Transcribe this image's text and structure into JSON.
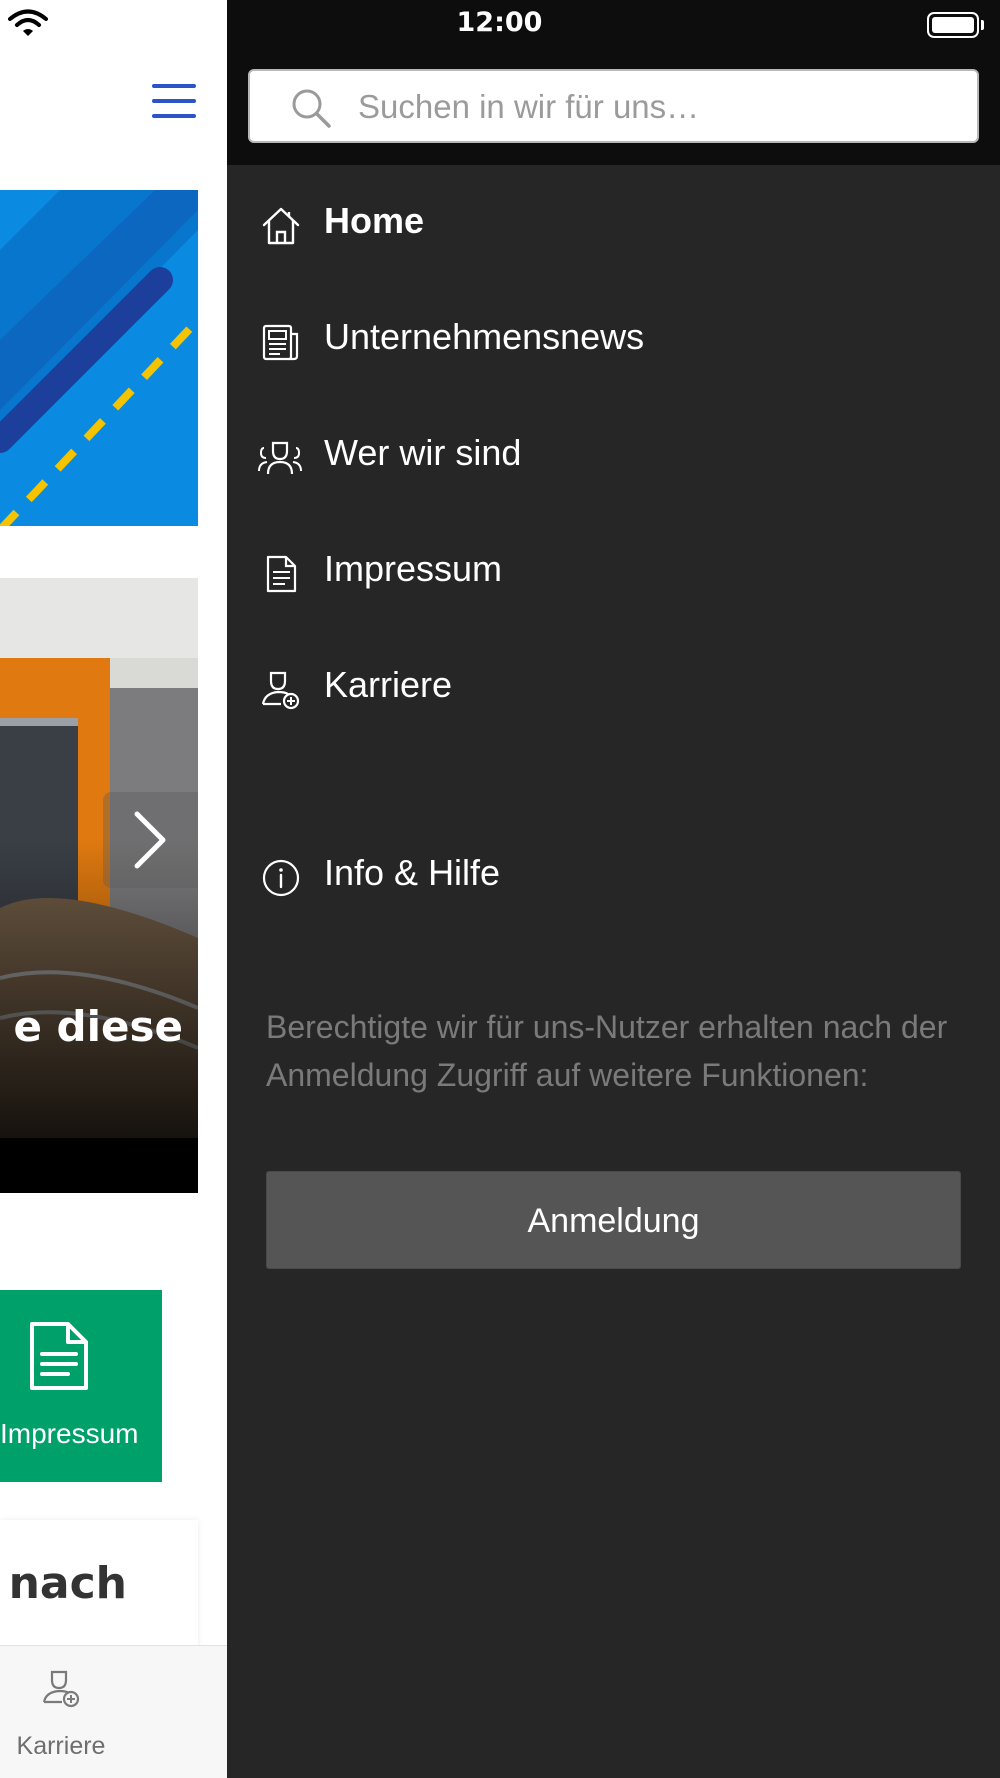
{
  "status_bar": {
    "time": "12:00"
  },
  "background_app": {
    "banner_caption_fragment": "e diese",
    "tile": {
      "label": "Impressum",
      "icon": "document-icon",
      "color": "#00a06a"
    },
    "card_text_fragment": "t nach",
    "tabbar": {
      "items": [
        {
          "label": "Karriere",
          "icon": "person-add-icon"
        }
      ]
    },
    "accent_color": "#2c53c9"
  },
  "drawer": {
    "search": {
      "placeholder": "Suchen in wir für uns…",
      "value": ""
    },
    "menu": [
      {
        "label": "Home",
        "icon": "home-icon",
        "active": true
      },
      {
        "label": "Unternehmensnews",
        "icon": "newspaper-icon",
        "active": false
      },
      {
        "label": "Wer wir sind",
        "icon": "team-icon",
        "active": false
      },
      {
        "label": "Impressum",
        "icon": "document-icon",
        "active": false
      },
      {
        "label": "Karriere",
        "icon": "person-add-icon",
        "active": false
      }
    ],
    "info_item": {
      "label": "Info & Hilfe",
      "icon": "info-icon"
    },
    "login_hint": "Berechtigte wir für uns-Nutzer erhalten nach der Anmeldung Zugriff auf weitere Funktionen:",
    "login_button": "Anmeldung",
    "background_color": "#262626"
  }
}
